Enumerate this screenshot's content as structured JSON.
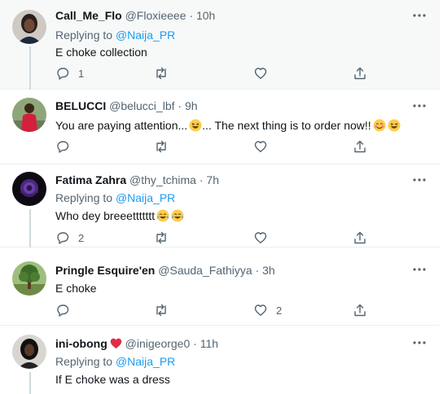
{
  "tweets": [
    {
      "name": "Call_Me_Flo",
      "handle": "@Floxieeee",
      "time": "10h",
      "replying_prefix": "Replying to",
      "replying_to": "@Naija_PR",
      "text": "E choke collection",
      "replies": "1",
      "likes": "",
      "avatar_icon": "woman-portrait-avatar",
      "highlighted": true
    },
    {
      "name": "BELUCCI",
      "handle": "@belucci_lbf",
      "time": "9h",
      "text_part1": "You are paying attention...",
      "text_part2": "... The next thing is to order now!!",
      "emojis": [
        "grinning-squinting-emoji",
        "smiling-blush-emoji",
        "grinning-squinting-emoji"
      ],
      "replies": "",
      "likes": "",
      "avatar_icon": "man-red-shirt-avatar"
    },
    {
      "name": "Fatima Zahra",
      "handle": "@thy_tchima",
      "time": "7h",
      "replying_prefix": "Replying to",
      "replying_to": "@Naija_PR",
      "text": "Who dey breeettttttt",
      "emojis": [
        "tears-of-joy-emoji",
        "tears-of-joy-emoji"
      ],
      "replies": "2",
      "likes": "",
      "avatar_icon": "purple-rose-avatar"
    },
    {
      "name": "Pringle Esquire'en",
      "handle": "@Sauda_Fathiyya",
      "time": "3h",
      "text": "E choke",
      "replies": "",
      "likes": "2",
      "avatar_icon": "tree-landscape-avatar"
    },
    {
      "name": "ini-obong",
      "handle": "@inigeorge0",
      "time": "11h",
      "replying_prefix": "Replying to",
      "replying_to": "@Naija_PR",
      "text": "If E choke was a dress",
      "name_badge": "red-heart-emoji",
      "avatar_icon": "woman-dark-avatar"
    }
  ],
  "separators": {
    "dot": "·"
  },
  "colors": {
    "accent": "#1d9bf0",
    "muted": "#536471",
    "text": "#0f1419",
    "highlight_bg": "#f7f9f9"
  }
}
